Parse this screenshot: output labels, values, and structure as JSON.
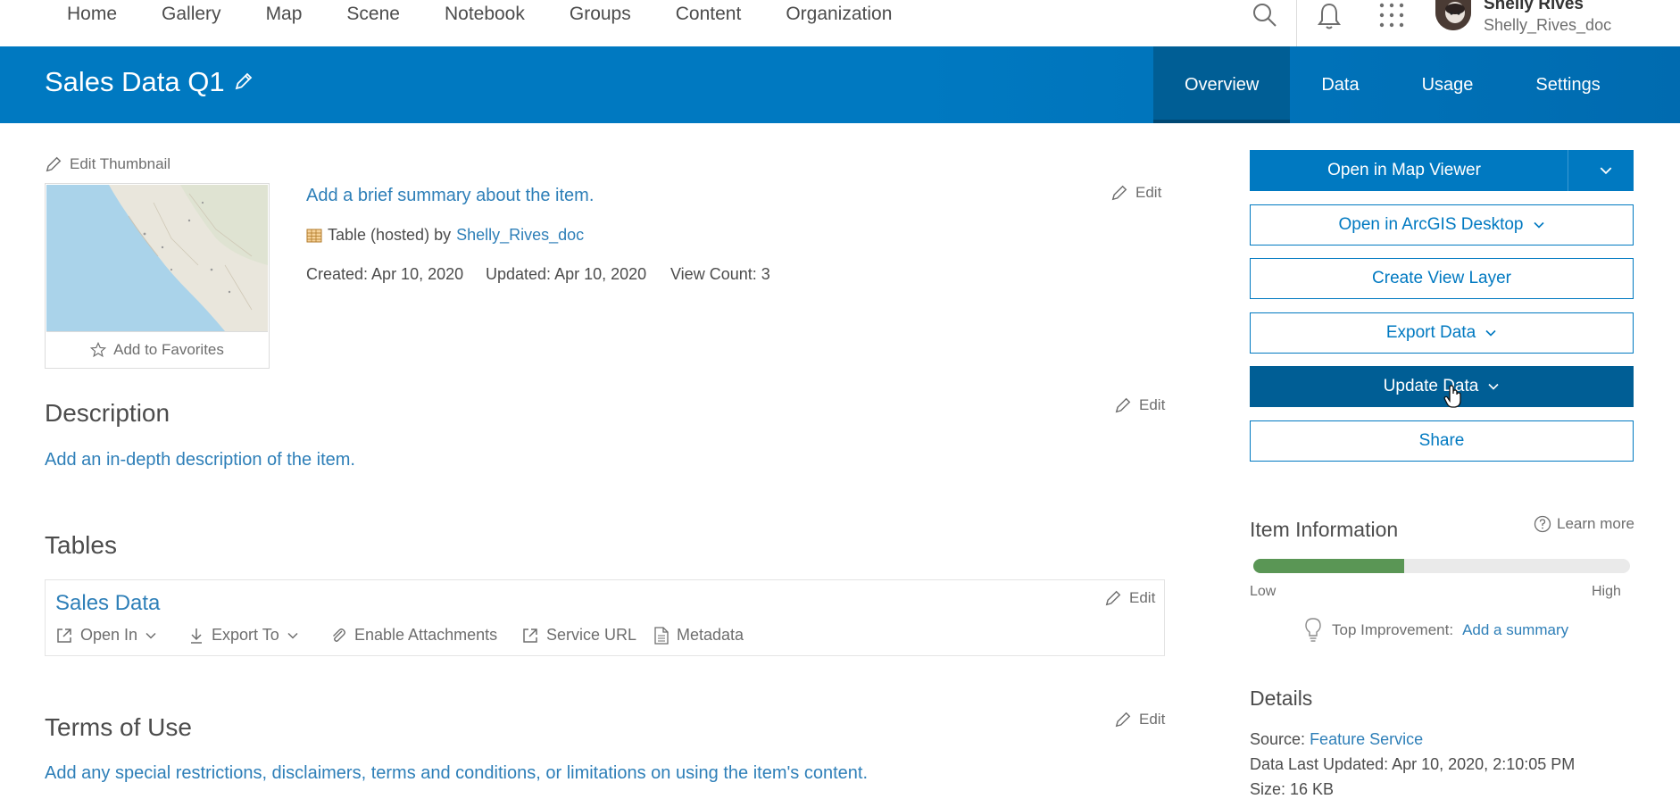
{
  "nav": {
    "links": [
      "Home",
      "Gallery",
      "Map",
      "Scene",
      "Notebook",
      "Groups",
      "Content",
      "Organization"
    ],
    "user_name": "Shelly Rives",
    "user_id": "Shelly_Rives_doc"
  },
  "header": {
    "title": "Sales Data Q1",
    "tabs": [
      "Overview",
      "Data",
      "Usage",
      "Settings"
    ],
    "active_tab": "Overview"
  },
  "summary": {
    "edit_thumbnail": "Edit Thumbnail",
    "add_to_favorites": "Add to Favorites",
    "summary_prompt": "Add a brief summary about the item.",
    "edit_label": "Edit",
    "item_type": "Table (hosted) by",
    "owner": "Shelly_Rives_doc",
    "created": "Created: Apr 10, 2020",
    "updated": "Updated: Apr 10, 2020",
    "view_count": "View Count: 3"
  },
  "description": {
    "heading": "Description",
    "edit_label": "Edit",
    "prompt": "Add an in-depth description of the item."
  },
  "tables": {
    "heading": "Tables",
    "table_name": "Sales Data",
    "edit_label": "Edit",
    "actions": {
      "open_in": "Open In",
      "export_to": "Export To",
      "enable_attachments": "Enable Attachments",
      "service_url": "Service URL",
      "metadata": "Metadata"
    }
  },
  "terms": {
    "heading": "Terms of Use",
    "edit_label": "Edit",
    "prompt": "Add any special restrictions, disclaimers, terms and conditions, or limitations on using the item's content."
  },
  "actions": {
    "open_map_viewer": "Open in Map Viewer",
    "open_arcgis_desktop": "Open in ArcGIS Desktop",
    "create_view_layer": "Create View Layer",
    "export_data": "Export Data",
    "update_data": "Update Data",
    "share": "Share"
  },
  "item_info": {
    "heading": "Item Information",
    "learn_more": "Learn more",
    "low": "Low",
    "high": "High",
    "score_fraction": 0.4,
    "top_improvement_label": "Top Improvement:",
    "top_improvement_link": "Add a summary"
  },
  "details": {
    "heading": "Details",
    "source_label": "Source:",
    "source_value": "Feature Service",
    "last_updated": "Data Last Updated: Apr 10, 2020, 2:10:05 PM",
    "size_partial": "Size: 16 KB"
  },
  "colors": {
    "header_blue": "#0079c1",
    "active_tab": "#005e95",
    "link_blue": "#2e7fb8",
    "meter_green": "#5a9655"
  }
}
